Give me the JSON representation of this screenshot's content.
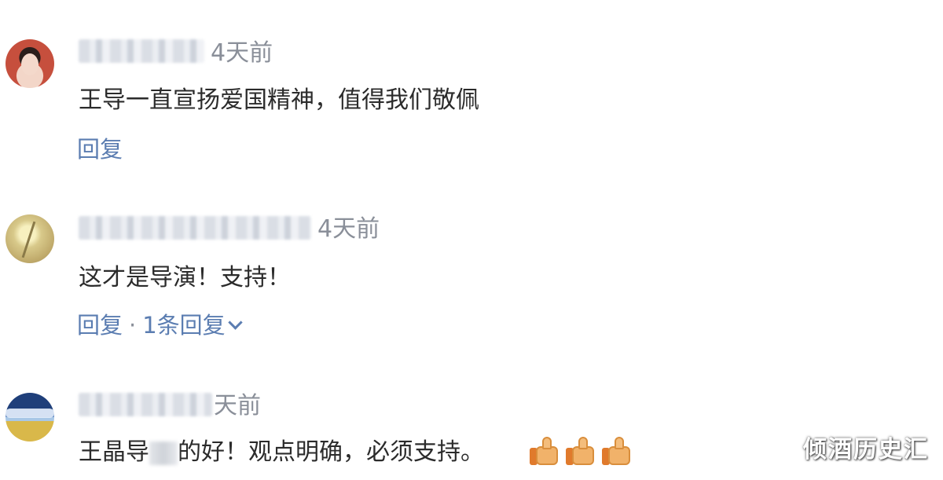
{
  "comments": [
    {
      "time": "4天前",
      "text": "王导一直宣扬爱国精神，值得我们敬佩",
      "reply_label": "回复"
    },
    {
      "time": "4天前",
      "text": "这才是导演！支持！",
      "reply_label": "回复",
      "separator": "·",
      "replies_count": "1条回复"
    },
    {
      "time": "天前",
      "text_part1": "王晶导",
      "text_part2": "的好！观点明确，必须支持。",
      "thumbs_icons": [
        "thumbs-up-icon",
        "thumbs-up-icon",
        "thumbs-up-icon"
      ]
    }
  ],
  "watermark": "倾酒历史汇",
  "colors": {
    "link": "#5b7db1",
    "time": "#8a8f99",
    "text": "#2b2b2b"
  }
}
